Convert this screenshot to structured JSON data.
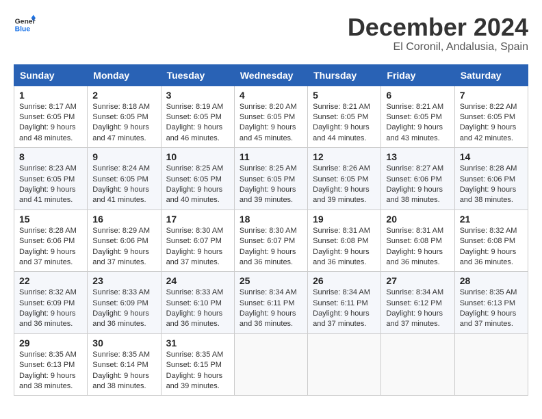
{
  "logo": {
    "line1": "General",
    "line2": "Blue"
  },
  "title": "December 2024",
  "subtitle": "El Coronil, Andalusia, Spain",
  "headers": [
    "Sunday",
    "Monday",
    "Tuesday",
    "Wednesday",
    "Thursday",
    "Friday",
    "Saturday"
  ],
  "weeks": [
    [
      {
        "day": "1",
        "sunrise": "8:17 AM",
        "sunset": "6:05 PM",
        "daylight": "9 hours and 48 minutes."
      },
      {
        "day": "2",
        "sunrise": "8:18 AM",
        "sunset": "6:05 PM",
        "daylight": "9 hours and 47 minutes."
      },
      {
        "day": "3",
        "sunrise": "8:19 AM",
        "sunset": "6:05 PM",
        "daylight": "9 hours and 46 minutes."
      },
      {
        "day": "4",
        "sunrise": "8:20 AM",
        "sunset": "6:05 PM",
        "daylight": "9 hours and 45 minutes."
      },
      {
        "day": "5",
        "sunrise": "8:21 AM",
        "sunset": "6:05 PM",
        "daylight": "9 hours and 44 minutes."
      },
      {
        "day": "6",
        "sunrise": "8:21 AM",
        "sunset": "6:05 PM",
        "daylight": "9 hours and 43 minutes."
      },
      {
        "day": "7",
        "sunrise": "8:22 AM",
        "sunset": "6:05 PM",
        "daylight": "9 hours and 42 minutes."
      }
    ],
    [
      {
        "day": "8",
        "sunrise": "8:23 AM",
        "sunset": "6:05 PM",
        "daylight": "9 hours and 41 minutes."
      },
      {
        "day": "9",
        "sunrise": "8:24 AM",
        "sunset": "6:05 PM",
        "daylight": "9 hours and 41 minutes."
      },
      {
        "day": "10",
        "sunrise": "8:25 AM",
        "sunset": "6:05 PM",
        "daylight": "9 hours and 40 minutes."
      },
      {
        "day": "11",
        "sunrise": "8:25 AM",
        "sunset": "6:05 PM",
        "daylight": "9 hours and 39 minutes."
      },
      {
        "day": "12",
        "sunrise": "8:26 AM",
        "sunset": "6:05 PM",
        "daylight": "9 hours and 39 minutes."
      },
      {
        "day": "13",
        "sunrise": "8:27 AM",
        "sunset": "6:06 PM",
        "daylight": "9 hours and 38 minutes."
      },
      {
        "day": "14",
        "sunrise": "8:28 AM",
        "sunset": "6:06 PM",
        "daylight": "9 hours and 38 minutes."
      }
    ],
    [
      {
        "day": "15",
        "sunrise": "8:28 AM",
        "sunset": "6:06 PM",
        "daylight": "9 hours and 37 minutes."
      },
      {
        "day": "16",
        "sunrise": "8:29 AM",
        "sunset": "6:06 PM",
        "daylight": "9 hours and 37 minutes."
      },
      {
        "day": "17",
        "sunrise": "8:30 AM",
        "sunset": "6:07 PM",
        "daylight": "9 hours and 37 minutes."
      },
      {
        "day": "18",
        "sunrise": "8:30 AM",
        "sunset": "6:07 PM",
        "daylight": "9 hours and 36 minutes."
      },
      {
        "day": "19",
        "sunrise": "8:31 AM",
        "sunset": "6:08 PM",
        "daylight": "9 hours and 36 minutes."
      },
      {
        "day": "20",
        "sunrise": "8:31 AM",
        "sunset": "6:08 PM",
        "daylight": "9 hours and 36 minutes."
      },
      {
        "day": "21",
        "sunrise": "8:32 AM",
        "sunset": "6:08 PM",
        "daylight": "9 hours and 36 minutes."
      }
    ],
    [
      {
        "day": "22",
        "sunrise": "8:32 AM",
        "sunset": "6:09 PM",
        "daylight": "9 hours and 36 minutes."
      },
      {
        "day": "23",
        "sunrise": "8:33 AM",
        "sunset": "6:09 PM",
        "daylight": "9 hours and 36 minutes."
      },
      {
        "day": "24",
        "sunrise": "8:33 AM",
        "sunset": "6:10 PM",
        "daylight": "9 hours and 36 minutes."
      },
      {
        "day": "25",
        "sunrise": "8:34 AM",
        "sunset": "6:11 PM",
        "daylight": "9 hours and 36 minutes."
      },
      {
        "day": "26",
        "sunrise": "8:34 AM",
        "sunset": "6:11 PM",
        "daylight": "9 hours and 37 minutes."
      },
      {
        "day": "27",
        "sunrise": "8:34 AM",
        "sunset": "6:12 PM",
        "daylight": "9 hours and 37 minutes."
      },
      {
        "day": "28",
        "sunrise": "8:35 AM",
        "sunset": "6:13 PM",
        "daylight": "9 hours and 37 minutes."
      }
    ],
    [
      {
        "day": "29",
        "sunrise": "8:35 AM",
        "sunset": "6:13 PM",
        "daylight": "9 hours and 38 minutes."
      },
      {
        "day": "30",
        "sunrise": "8:35 AM",
        "sunset": "6:14 PM",
        "daylight": "9 hours and 38 minutes."
      },
      {
        "day": "31",
        "sunrise": "8:35 AM",
        "sunset": "6:15 PM",
        "daylight": "9 hours and 39 minutes."
      },
      null,
      null,
      null,
      null
    ]
  ]
}
